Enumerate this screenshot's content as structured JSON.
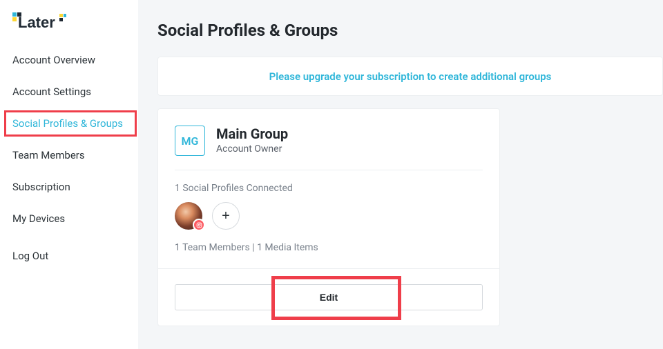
{
  "brand": {
    "name": "Later"
  },
  "sidebar": {
    "items": [
      {
        "label": "Account Overview"
      },
      {
        "label": "Account Settings"
      },
      {
        "label": "Social Profiles & Groups"
      },
      {
        "label": "Team Members"
      },
      {
        "label": "Subscription"
      },
      {
        "label": "My Devices"
      }
    ],
    "logout_label": "Log Out"
  },
  "page": {
    "title": "Social Profiles & Groups",
    "upgrade_banner": "Please upgrade your subscription to create additional groups"
  },
  "group": {
    "badge": "MG",
    "name": "Main Group",
    "role": "Account Owner",
    "profiles_connected_label": "1 Social Profiles Connected",
    "stats_label": "1 Team Members | 1 Media Items",
    "edit_label": "Edit",
    "add_profile_glyph": "+",
    "profile_network": "instagram"
  }
}
